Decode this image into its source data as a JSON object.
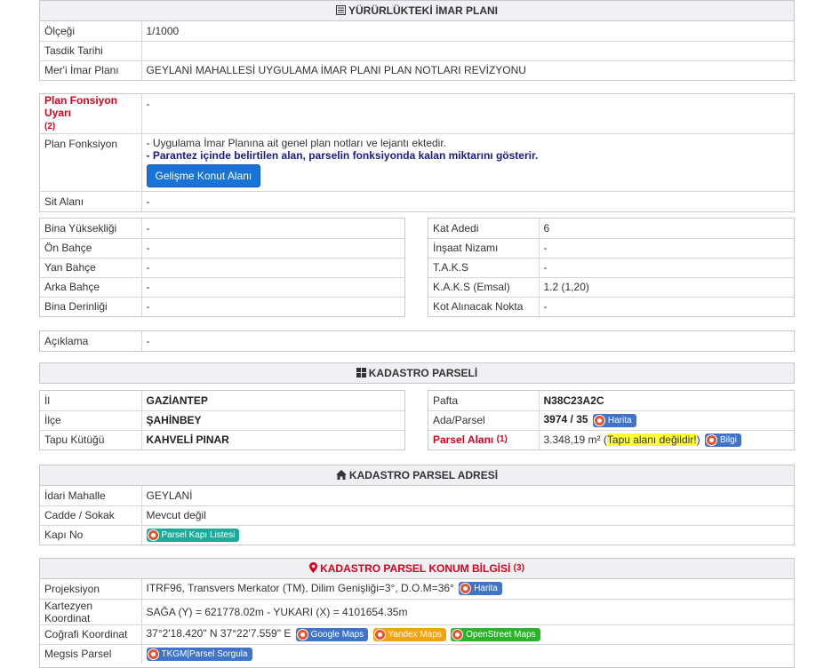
{
  "imar": {
    "title": "YÜRÜRLÜKTEKİ İMAR PLANI",
    "rows": [
      {
        "label": "Ölçeği",
        "value": "1/1000"
      },
      {
        "label": "Tasdik Tarihi",
        "value": ""
      },
      {
        "label": "Mer'i İmar Planı",
        "value": "GEYLANİ MAHALLESİ UYGULAMA İMAR PLANI PLAN NOTLARI REVİZYONU"
      }
    ]
  },
  "fonksiyon": {
    "uyari_label": "Plan Fonsiyon Uyarı",
    "uyari_sup": "(2)",
    "uyari_value": "-",
    "fonksiyon_label": "Plan Fonksiyon",
    "fonksiyon_line1": "- Uygulama İmar Planına ait genel plan notları ve lejantı ektedir.",
    "fonksiyon_line2": "- Parantez içinde belirtilen alan, parselin fonksiyonda kalan miktarını gösterir.",
    "button": "Gelişme Konut Alanı",
    "sit_label": "Sit Alanı",
    "sit_value": "-"
  },
  "bina_left": [
    {
      "label": "Bina Yüksekliği",
      "value": "-"
    },
    {
      "label": "Ön Bahçe",
      "value": "-"
    },
    {
      "label": "Yan Bahçe",
      "value": "-"
    },
    {
      "label": "Arka Bahçe",
      "value": "-"
    },
    {
      "label": "Bina Derinliği",
      "value": "-"
    }
  ],
  "bina_right": [
    {
      "label": "Kat Adedi",
      "value": "6"
    },
    {
      "label": "İnşaat Nizamı",
      "value": "-"
    },
    {
      "label": "T.A.K.S",
      "value": "-"
    },
    {
      "label": "K.A.K.S (Emsal)",
      "value": "1.2 (1,20)"
    },
    {
      "label": "Kot Alınacak Nokta",
      "value": "-"
    }
  ],
  "aciklama": {
    "label": "Açıklama",
    "value": "-"
  },
  "kadastro": {
    "title": "KADASTRO PARSELİ",
    "left": [
      {
        "label": "İl",
        "value": "GAZİANTEP"
      },
      {
        "label": "İlçe",
        "value": "ŞAHİNBEY"
      },
      {
        "label": "Tapu Kütüğü",
        "value": "KAHVELİ PINAR"
      }
    ],
    "pafta_label": "Pafta",
    "pafta_value": "N38C23A2C",
    "ada_label": "Ada/Parsel",
    "ada_value": "3974 / 35",
    "harita_label": "Harita",
    "alan_label": "Parsel Alanı",
    "alan_sup": "(1)",
    "alan_value": "3.348,19 m²",
    "alan_note_open": "(",
    "alan_note": "Tapu alanı değildir!",
    "alan_note_close": ")",
    "bilgi_label": "Bilgi"
  },
  "adres": {
    "title": "KADASTRO PARSEL ADRESİ",
    "rows": [
      {
        "label": "İdari Mahalle",
        "value": "GEYLANİ"
      },
      {
        "label": "Cadde / Sokak",
        "value": "Mevcut değil"
      }
    ],
    "kapi_label": "Kapı No",
    "kapi_button": "Parsel Kapı Listesi"
  },
  "konum": {
    "title": "KADASTRO PARSEL KONUM BİLGİSİ",
    "title_sup": "(3)",
    "projeksiyon_label": "Projeksiyon",
    "projeksiyon_value": "ITRF96, Transvers Merkator (TM), Dilim Genişliği=3°, D.O.M=36°",
    "harita_label": "Harita",
    "kartezyen_label": "Kartezyen Koordinat",
    "kartezyen_value": "SAĞA (Y) = 621778.02m - YUKARI (X) = 4101654.35m",
    "cografi_label": "Coğrafi Koordinat",
    "cografi_value": "37°2'18.420\" N 37°22'7.559\" E",
    "google_label": "Google Maps",
    "yandex_label": "Yandex Maps",
    "osm_label": "OpenStreet Maps",
    "megsis_label": "Megsis Parsel",
    "tkgm_label": "TKGM|Parsel Sorgula"
  },
  "colors": {
    "accent_red": "#d9001b",
    "header_bg": "#eef0f3",
    "primary_button": "#1a73d6"
  }
}
